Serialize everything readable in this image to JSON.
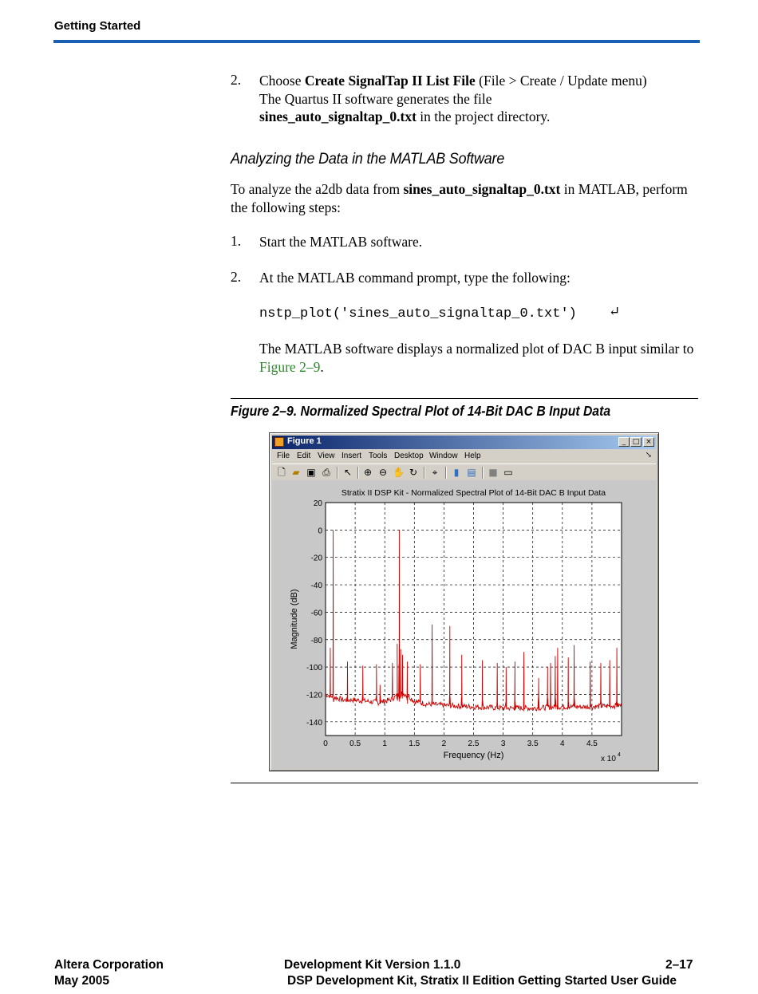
{
  "header": {
    "title": "Getting Started"
  },
  "step_create": {
    "number": "2.",
    "text_before": "Choose ",
    "bold_command": "Create SignalTap II List File",
    "text_after": " (File > Create / Update menu)",
    "line2": "The Quartus II software generates the file",
    "bold_file": "sines_auto_signaltap_0.txt",
    "line3_after": " in the project directory."
  },
  "section": {
    "heading": "Analyzing the Data in the MATLAB Software"
  },
  "intro": {
    "before": "To analyze the a2db data from ",
    "bold_file": "sines_auto_signaltap_0.txt",
    "after": " in MATLAB, perform the following steps:"
  },
  "steps": [
    {
      "number": "1.",
      "text": "Start the MATLAB software."
    },
    {
      "number": "2.",
      "text": "At the MATLAB command prompt, type the following:"
    }
  ],
  "code": {
    "command": "nstp_plot('sines_auto_signaltap_0.txt')",
    "enter_icon": "↵"
  },
  "result": {
    "text": "The MATLAB software displays a normalized plot of DAC B input similar to ",
    "link": "Figure 2–9",
    "end": "."
  },
  "figure": {
    "caption": "Figure 2–9. Normalized Spectral Plot of 14-Bit DAC B Input Data"
  },
  "window": {
    "title": "Figure 1",
    "menu": [
      "File",
      "Edit",
      "View",
      "Insert",
      "Tools",
      "Desktop",
      "Window",
      "Help"
    ],
    "toolbar_icons": [
      "new-figure-icon",
      "open-file-icon",
      "save-icon",
      "print-icon",
      "pointer-icon",
      "zoom-in-icon",
      "zoom-out-icon",
      "pan-icon",
      "rotate-icon",
      "data-cursor-icon",
      "colorbar-icon",
      "legend-icon",
      "hide-plot-tools-icon",
      "show-plot-tools-icon"
    ]
  },
  "chart_data": {
    "type": "line",
    "title": "Stratix II DSP Kit - Normalized Spectral Plot of 14-Bit DAC B Input Data",
    "xlabel": "Frequency (Hz)",
    "ylabel": "Magnitude (dB)",
    "x_multiplier": "x 10",
    "x_multiplier_exp": "4",
    "xlim": [
      0,
      50000
    ],
    "ylim": [
      -150,
      20
    ],
    "xticks": [
      0,
      5000,
      10000,
      15000,
      20000,
      25000,
      30000,
      35000,
      40000,
      45000
    ],
    "xtick_labels": [
      "0",
      "0.5",
      "1",
      "1.5",
      "2",
      "2.5",
      "3",
      "3.5",
      "4",
      "4.5"
    ],
    "yticks": [
      20,
      0,
      -20,
      -40,
      -60,
      -80,
      -100,
      -120,
      -140
    ],
    "ytick_labels": [
      "20",
      "0",
      "-20",
      "-40",
      "-60",
      "-80",
      "-100",
      "-120",
      "-140"
    ],
    "grid": true,
    "series_color": "#cc0000",
    "noise_floor": [
      [
        0,
        -120
      ],
      [
        1500,
        -122
      ],
      [
        3000,
        -124
      ],
      [
        5000,
        -124
      ],
      [
        7000,
        -125
      ],
      [
        9000,
        -126
      ],
      [
        11000,
        -124
      ],
      [
        12000,
        -121
      ],
      [
        13000,
        -119
      ],
      [
        14000,
        -121
      ],
      [
        15000,
        -125
      ],
      [
        17000,
        -127
      ],
      [
        20000,
        -128
      ],
      [
        25000,
        -129
      ],
      [
        30000,
        -130
      ],
      [
        35000,
        -130
      ],
      [
        40000,
        -129
      ],
      [
        45000,
        -129
      ],
      [
        50000,
        -128
      ]
    ],
    "peaks": [
      [
        800,
        -86
      ],
      [
        1300,
        0
      ],
      [
        3700,
        -96
      ],
      [
        6300,
        -99
      ],
      [
        8600,
        -98
      ],
      [
        9200,
        -113
      ],
      [
        11300,
        -97
      ],
      [
        12100,
        -83
      ],
      [
        12400,
        -98
      ],
      [
        12700,
        -87
      ],
      [
        13000,
        -91
      ],
      [
        12450,
        0
      ],
      [
        13800,
        -96
      ],
      [
        16000,
        -98
      ],
      [
        18000,
        -69
      ],
      [
        21000,
        -70
      ],
      [
        23000,
        -91
      ],
      [
        26500,
        -95
      ],
      [
        29000,
        -97
      ],
      [
        30500,
        -100
      ],
      [
        32000,
        -96
      ],
      [
        33500,
        -89
      ],
      [
        36000,
        -108
      ],
      [
        37500,
        -100
      ],
      [
        38000,
        -97
      ],
      [
        38800,
        -92
      ],
      [
        39200,
        -86
      ],
      [
        41000,
        -93
      ],
      [
        42000,
        -84
      ],
      [
        44700,
        -96
      ],
      [
        46500,
        -97
      ],
      [
        48000,
        -95
      ],
      [
        49200,
        -86
      ]
    ]
  },
  "footer": {
    "left1": "Altera Corporation",
    "left2": "May 2005",
    "center1": "Development Kit Version 1.1.0",
    "center2": "DSP Development Kit, Stratix II Edition Getting Started User Guide",
    "right1": "2–17"
  }
}
